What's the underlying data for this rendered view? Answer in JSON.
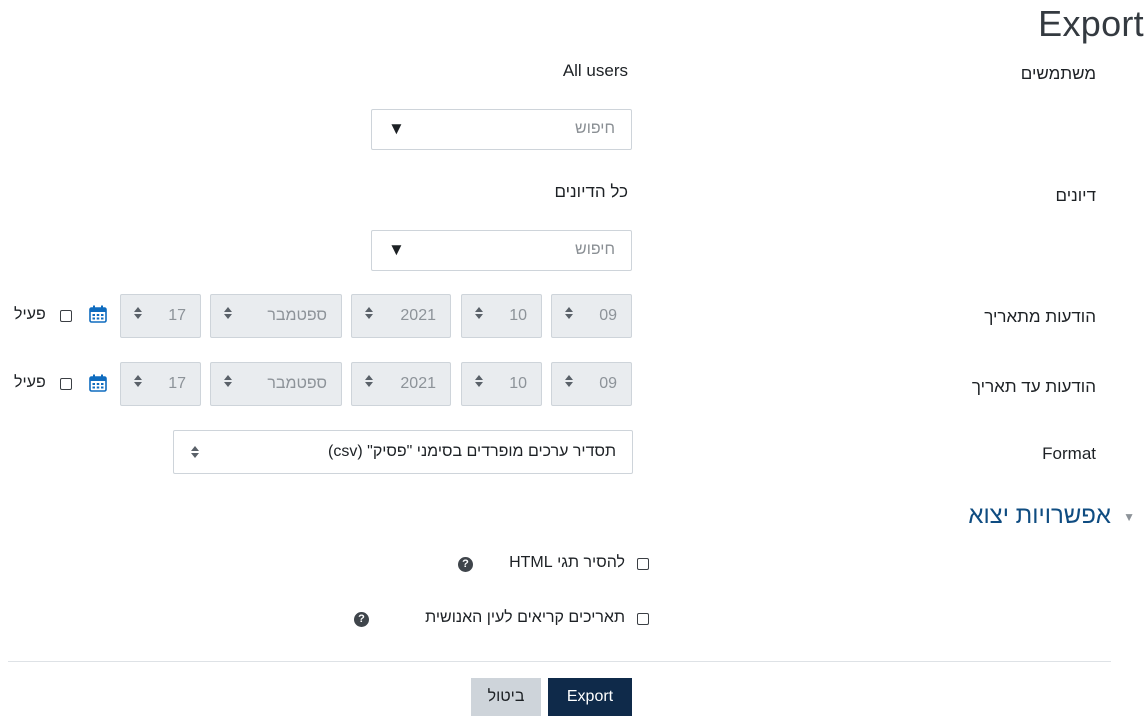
{
  "page": {
    "title": "Export"
  },
  "form": {
    "users": {
      "label": "משתמשים",
      "value": "All users",
      "search_placeholder": "חיפוש"
    },
    "discussions": {
      "label": "דיונים",
      "value": "כל הדיונים",
      "search_placeholder": "חיפוש"
    },
    "from_date": {
      "label": "הודעות מתאריך",
      "day": "17",
      "month": "ספטמבר",
      "year": "2021",
      "hour": "10",
      "minute": "09",
      "enable_label": "פעיל",
      "enabled": false,
      "calendar_icon": "calendar-icon"
    },
    "to_date": {
      "label": "הודעות עד תאריך",
      "day": "17",
      "month": "ספטמבר",
      "year": "2021",
      "hour": "10",
      "minute": "09",
      "enable_label": "פעיל",
      "enabled": false,
      "calendar_icon": "calendar-icon"
    },
    "format": {
      "label": "Format",
      "value": "תסדיר ערכים מופרדים בסימני \"פסיק\" (csv)"
    }
  },
  "export_options": {
    "heading": "אפשרויות יצוא",
    "strip_html": {
      "label": "להסיר תגי HTML",
      "checked": false,
      "help_icon": "question-circle-icon"
    },
    "human_dates": {
      "label": "תאריכים קריאים לעין האנושית",
      "checked": false,
      "help_icon": "question-circle-icon"
    }
  },
  "buttons": {
    "export": "Export",
    "cancel": "ביטול"
  },
  "colors": {
    "primary": "#0f2a4a",
    "link": "#0f4c81",
    "disabled_bg": "#e9ecef"
  }
}
